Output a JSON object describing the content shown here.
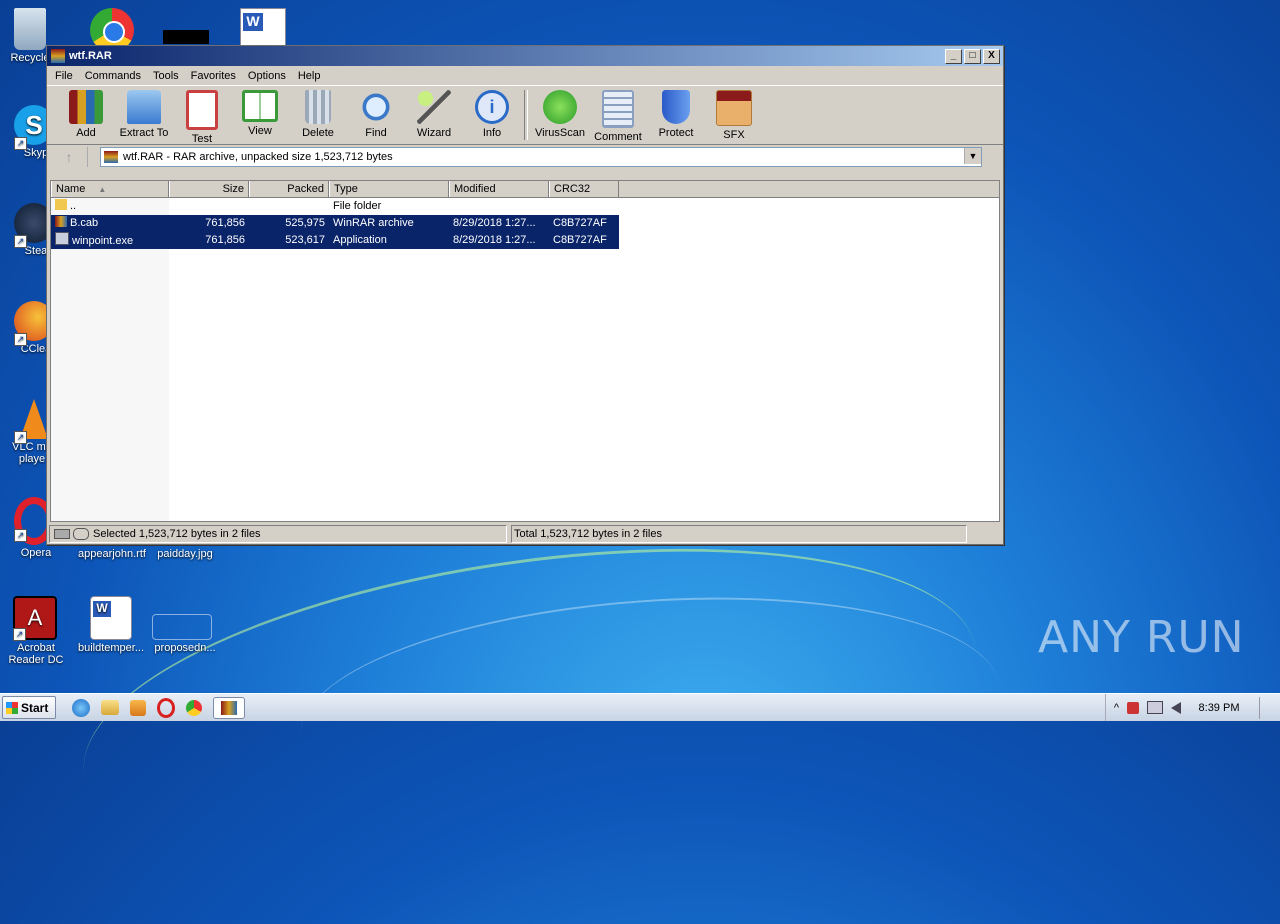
{
  "desktop": {
    "icons": [
      {
        "label": "Recycle"
      },
      {
        "label": "Skyp"
      },
      {
        "label": "Stea"
      },
      {
        "label": "CClea"
      },
      {
        "label": "VLC me playe"
      },
      {
        "label": "Opera"
      },
      {
        "label": "appearjohn.rtf"
      },
      {
        "label": "paidday.jpg"
      },
      {
        "label": "Acrobat Reader DC"
      },
      {
        "label": "buildtemper..."
      },
      {
        "label": "proposedn..."
      }
    ],
    "watermark": "ANY RUN"
  },
  "window": {
    "title": "wtf.RAR",
    "controls": {
      "minimize": "_",
      "maximize": "□",
      "close": "X"
    },
    "menu": [
      "File",
      "Commands",
      "Tools",
      "Favorites",
      "Options",
      "Help"
    ],
    "toolbar": [
      {
        "label": "Add",
        "icon": "add-archive-icon",
        "color": "#b83a2a"
      },
      {
        "label": "Extract To",
        "icon": "extract-folder-icon",
        "color": "#4a8fd8"
      },
      {
        "label": "Test",
        "icon": "test-clipboard-icon",
        "color": "#c84040"
      },
      {
        "label": "View",
        "icon": "view-book-icon",
        "color": "#3a9a3a"
      },
      {
        "label": "Delete",
        "icon": "delete-trash-icon",
        "color": "#8896a8"
      },
      {
        "label": "Find",
        "icon": "find-magnifier-icon",
        "color": "#3a78c8"
      },
      {
        "label": "Wizard",
        "icon": "wizard-wand-icon",
        "color": "#6ab84a"
      },
      {
        "label": "Info",
        "icon": "info-icon",
        "color": "#2a6ac8"
      },
      {
        "label": "VirusScan",
        "icon": "virusscan-icon",
        "color": "#3aa83a"
      },
      {
        "label": "Comment",
        "icon": "comment-icon",
        "color": "#8aa0c0"
      },
      {
        "label": "Protect",
        "icon": "protect-shield-icon",
        "color": "#2a5ac8"
      },
      {
        "label": "SFX",
        "icon": "sfx-box-icon",
        "color": "#d89a4a"
      }
    ],
    "address": "wtf.RAR - RAR archive, unpacked size 1,523,712 bytes",
    "columns": [
      "Name",
      "Size",
      "Packed",
      "Type",
      "Modified",
      "CRC32"
    ],
    "rows": [
      {
        "name": "..",
        "size": "",
        "packed": "",
        "type": "File folder",
        "modified": "",
        "crc": "",
        "selected": false,
        "icon": "folder-icon"
      },
      {
        "name": "B.cab",
        "size": "761,856",
        "packed": "525,975",
        "type": "WinRAR archive",
        "modified": "8/29/2018 1:27...",
        "crc": "C8B727AF",
        "selected": true,
        "icon": "rar-file-icon"
      },
      {
        "name": "winpoint.exe",
        "size": "761,856",
        "packed": "523,617",
        "type": "Application",
        "modified": "8/29/2018 1:27...",
        "crc": "C8B727AF",
        "selected": true,
        "icon": "exe-file-icon"
      }
    ],
    "status_left": "Selected 1,523,712 bytes in 2 files",
    "status_right": "Total 1,523,712 bytes in 2 files"
  },
  "taskbar": {
    "start_label": "Start",
    "clock": "8:39 PM",
    "tray_arrow": "^"
  }
}
